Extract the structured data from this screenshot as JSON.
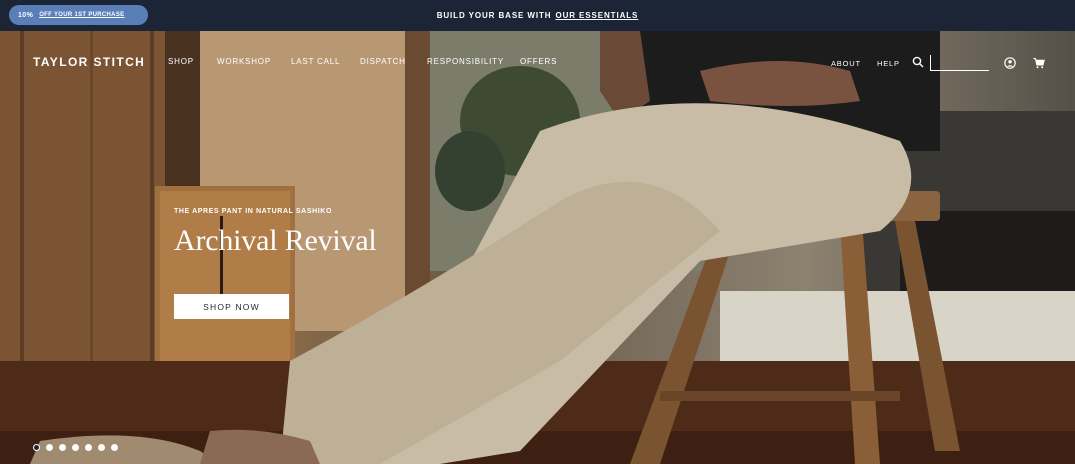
{
  "announcement": {
    "promo_percent": "10%",
    "promo_link": "OFF YOUR 1ST PURCHASE",
    "message": "BUILD YOUR BASE WITH",
    "message_link": "OUR ESSENTIALS"
  },
  "nav": {
    "logo": "TAYLOR STITCH",
    "items": [
      "SHOP",
      "WORKSHOP",
      "LAST CALL",
      "DISPATCH",
      "RESPONSIBILITY",
      "OFFERS"
    ],
    "utility": [
      "ABOUT",
      "HELP"
    ],
    "search_value": "",
    "icons": [
      "search-icon",
      "account-icon",
      "cart-icon"
    ]
  },
  "hero": {
    "eyebrow": "THE APRES PANT IN NATURAL SASHIKO",
    "headline": "Archival Revival",
    "cta": "SHOP NOW",
    "slide_count": 7,
    "active_slide": 1
  },
  "colors": {
    "topbar": "#1b2535",
    "promo_pill": "#5a7fb8",
    "cta_bg": "#ffffff",
    "cta_text": "#1b2535"
  }
}
